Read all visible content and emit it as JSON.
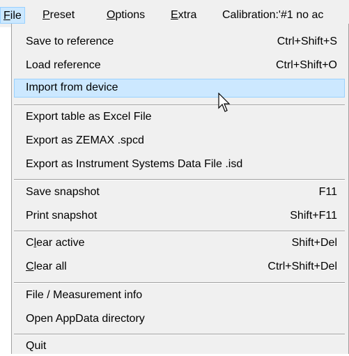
{
  "menubar": {
    "file": {
      "mnemonic": "F",
      "rest": "ile"
    },
    "preset": {
      "mnemonic": "P",
      "rest": "reset"
    },
    "options": {
      "mnemonic": "O",
      "rest": "ptions"
    },
    "extra": {
      "mnemonic": "E",
      "rest": "xtra"
    },
    "calibration": "Calibration:'#1 no ac"
  },
  "menu": {
    "items": [
      {
        "label": "Save to reference",
        "shortcut": "Ctrl+Shift+S"
      },
      {
        "label": "Load reference",
        "shortcut": "Ctrl+Shift+O"
      },
      {
        "label": "Import from device",
        "shortcut": ""
      },
      {
        "label": "Export table as Excel File",
        "shortcut": ""
      },
      {
        "label": "Export as ZEMAX .spcd",
        "shortcut": ""
      },
      {
        "label": "Export as Instrument Systems Data File .isd",
        "shortcut": ""
      },
      {
        "label": "Save snapshot",
        "shortcut": "F11"
      },
      {
        "label": "Print snapshot",
        "shortcut": "Shift+F11"
      },
      {
        "label_pre": "C",
        "label_mn": "l",
        "label_post": "ear active",
        "shortcut": "Shift+Del"
      },
      {
        "label_pre": "",
        "label_mn": "C",
        "label_post": "lear all",
        "shortcut": "Ctrl+Shift+Del"
      },
      {
        "label": "File / Measurement info",
        "shortcut": ""
      },
      {
        "label": "Open AppData directory",
        "shortcut": ""
      },
      {
        "label": "Quit",
        "shortcut": ""
      }
    ]
  },
  "colors": {
    "menu_background": "#f0f0f0",
    "highlight_fill": "#cce8ff",
    "highlight_border": "#99d1ff",
    "separator": "#a0a0a0"
  },
  "icons": {
    "cursor": "arrow-cursor-icon"
  }
}
